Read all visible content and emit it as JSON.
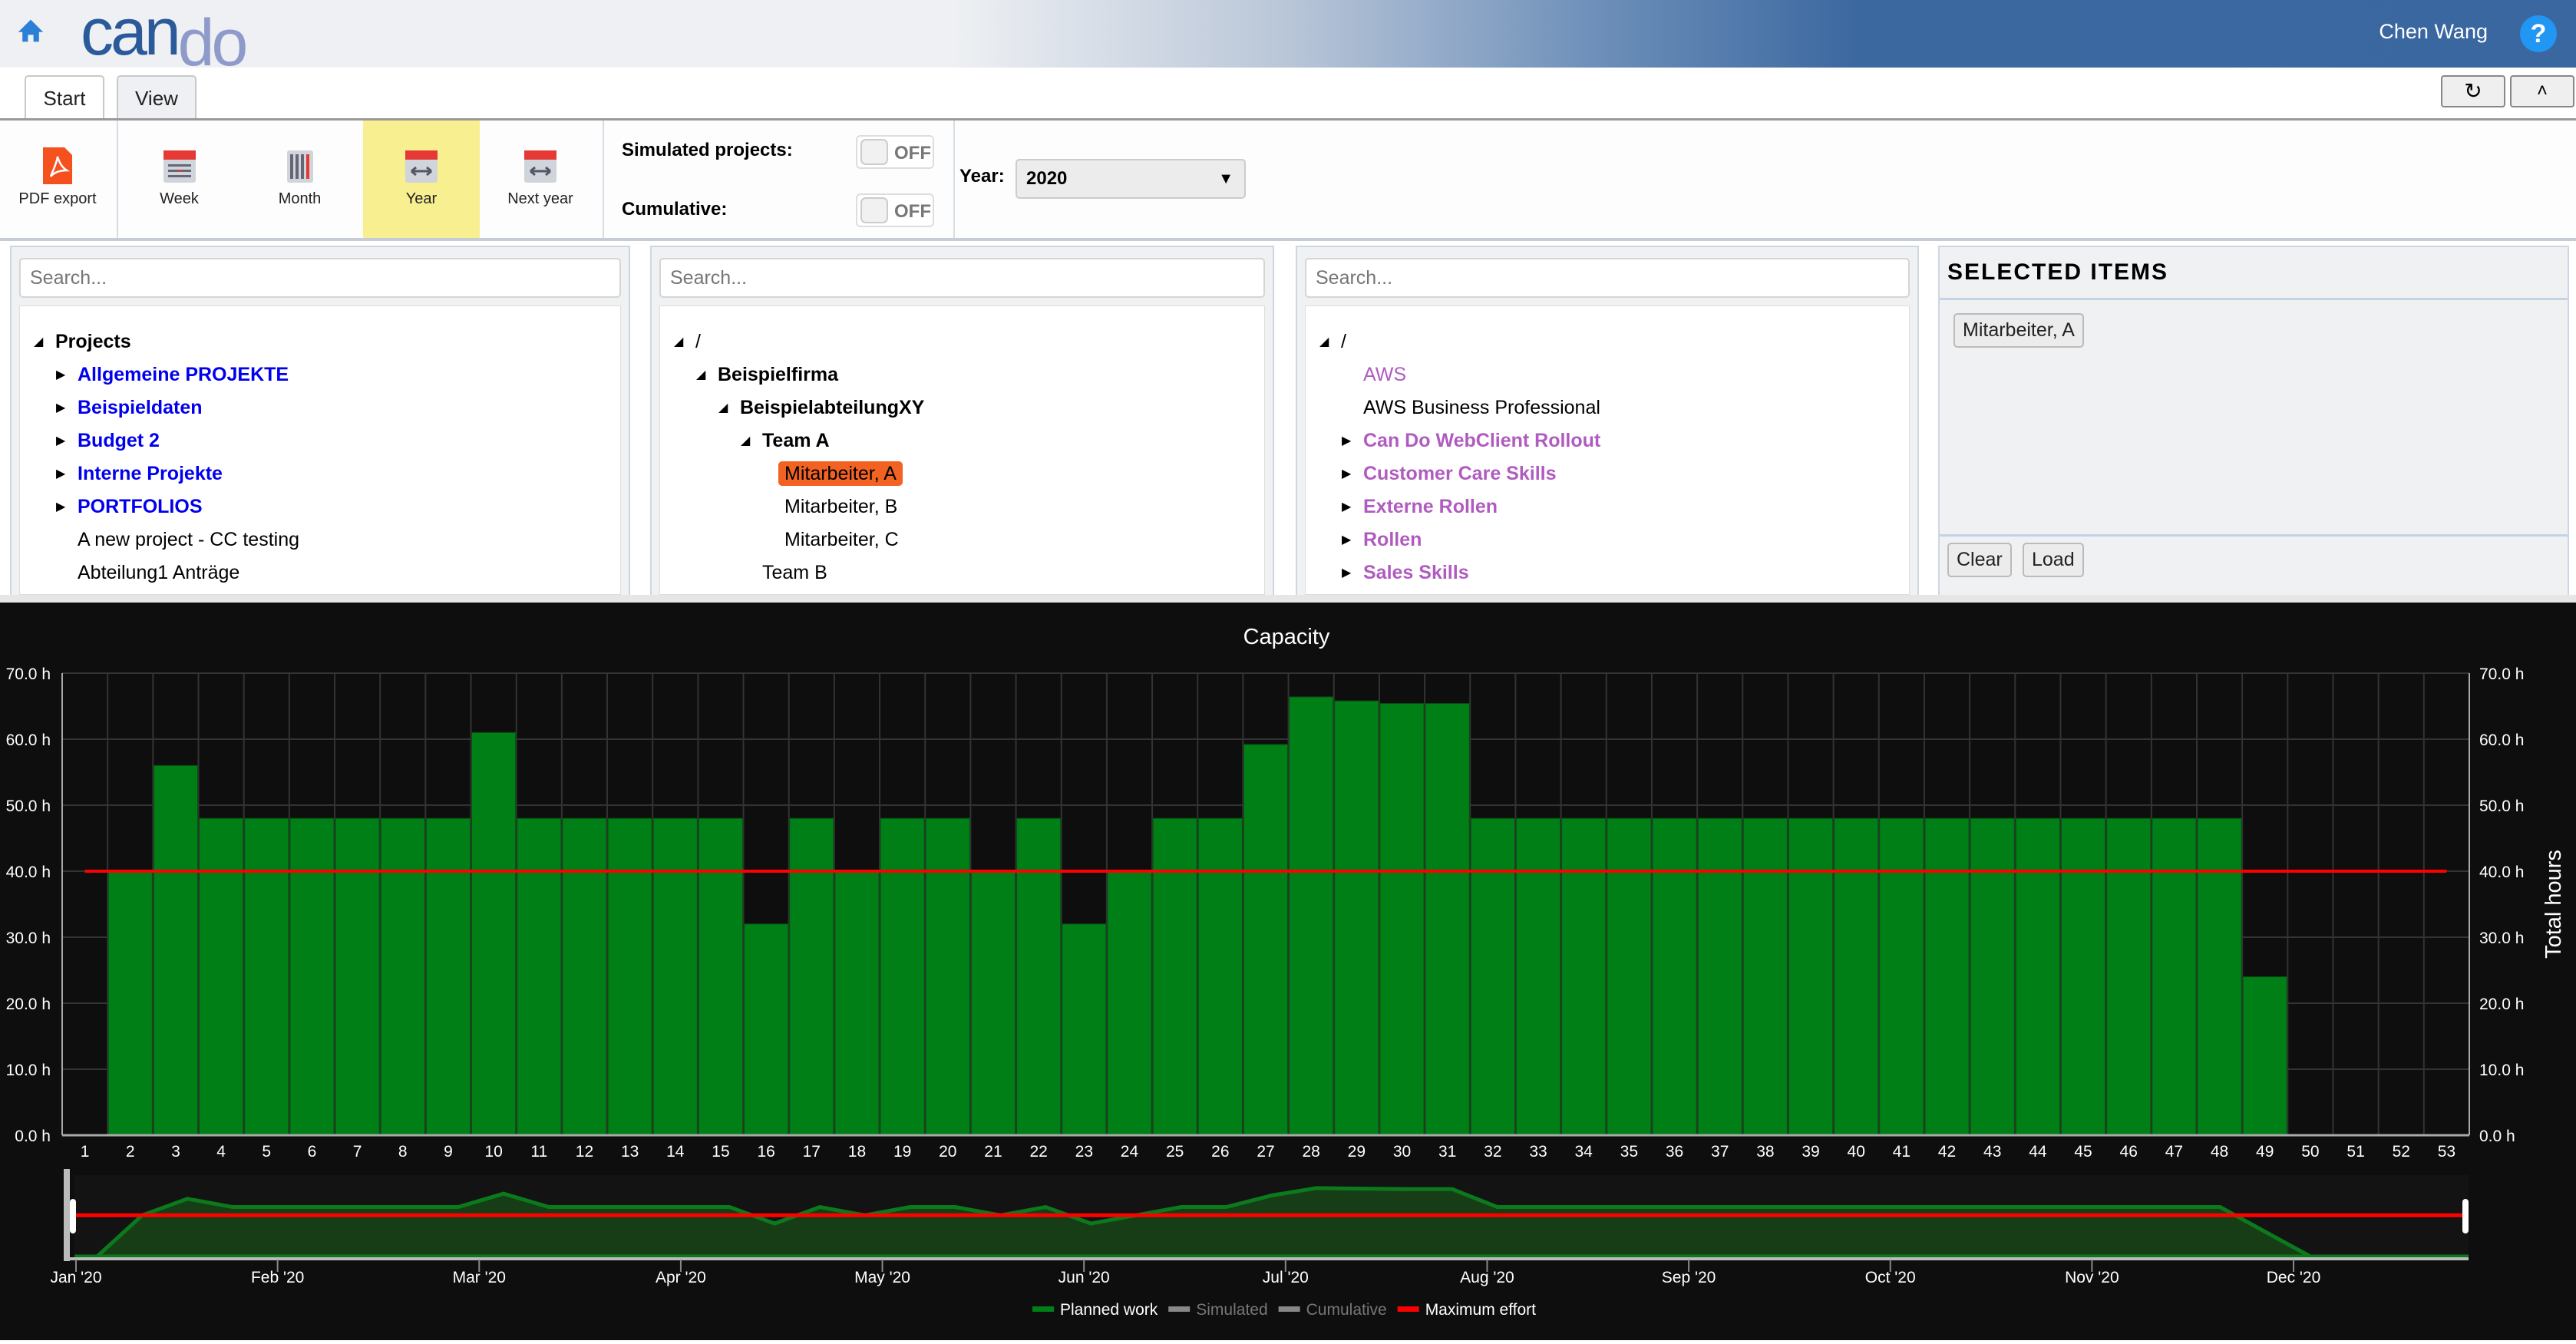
{
  "header": {
    "logo": "cando",
    "user": "Chen Wang",
    "help": "?"
  },
  "tabs": [
    {
      "label": "Start"
    },
    {
      "label": "View"
    }
  ],
  "toolbar": {
    "buttons": [
      {
        "label": "PDF export",
        "icon": "pdf-icon"
      },
      {
        "label": "Week",
        "icon": "calendar-week-icon"
      },
      {
        "label": "Month",
        "icon": "calendar-month-icon"
      },
      {
        "label": "Year",
        "icon": "calendar-year-icon",
        "active": true
      },
      {
        "label": "Next year",
        "icon": "calendar-next-year-icon"
      }
    ],
    "simulated_label": "Simulated projects:",
    "simulated_value": "OFF",
    "cumulative_label": "Cumulative:",
    "cumulative_value": "OFF",
    "year_label": "Year:",
    "year_value": "2020",
    "active_color": "#f8ef91"
  },
  "panels": {
    "search_placeholder": "Search...",
    "projects": [
      {
        "label": "Projects",
        "lvl": 0,
        "tri": "open",
        "style": "b"
      },
      {
        "label": "Allgemeine PROJEKTE",
        "lvl": 1,
        "tri": "closed",
        "style": "blue"
      },
      {
        "label": "Beispieldaten",
        "lvl": 1,
        "tri": "closed",
        "style": "blue"
      },
      {
        "label": "Budget 2",
        "lvl": 1,
        "tri": "closed",
        "style": "blue"
      },
      {
        "label": "Interne Projekte",
        "lvl": 1,
        "tri": "closed",
        "style": "blue"
      },
      {
        "label": "PORTFOLIOS",
        "lvl": 1,
        "tri": "closed",
        "style": "blue"
      },
      {
        "label": "A new project - CC testing",
        "lvl": 1,
        "tri": "",
        "style": ""
      },
      {
        "label": "Abteilung1 Anträge",
        "lvl": 1,
        "tri": "",
        "style": ""
      }
    ],
    "org": [
      {
        "label": "/",
        "lvl": 0,
        "tri": "open",
        "style": ""
      },
      {
        "label": "Beispielfirma",
        "lvl": 1,
        "tri": "open",
        "style": "b"
      },
      {
        "label": "BeispielabteilungXY",
        "lvl": 2,
        "tri": "open",
        "style": "b"
      },
      {
        "label": "Team A",
        "lvl": 3,
        "tri": "open",
        "style": "b"
      },
      {
        "label": "Mitarbeiter, A",
        "lvl": 4,
        "tri": "",
        "style": "sel"
      },
      {
        "label": "Mitarbeiter, B",
        "lvl": 4,
        "tri": "",
        "style": ""
      },
      {
        "label": "Mitarbeiter, C",
        "lvl": 4,
        "tri": "",
        "style": ""
      },
      {
        "label": "Team B",
        "lvl": 3,
        "tri": "",
        "style": ""
      }
    ],
    "roles": [
      {
        "label": "/",
        "lvl": 0,
        "tri": "open",
        "style": ""
      },
      {
        "label": "AWS",
        "lvl": 1,
        "tri": "",
        "style": "purple"
      },
      {
        "label": "AWS Business Professional",
        "lvl": 1,
        "tri": "",
        "style": ""
      },
      {
        "label": "Can Do WebClient Rollout",
        "lvl": 1,
        "tri": "closed",
        "style": "purpleb"
      },
      {
        "label": "Customer Care Skills",
        "lvl": 1,
        "tri": "closed",
        "style": "purpleb"
      },
      {
        "label": "Externe Rollen",
        "lvl": 1,
        "tri": "closed",
        "style": "purpleb"
      },
      {
        "label": "Rollen",
        "lvl": 1,
        "tri": "closed",
        "style": "purpleb"
      },
      {
        "label": "Sales Skills",
        "lvl": 1,
        "tri": "closed",
        "style": "purpleb"
      }
    ],
    "selected": {
      "title": "SELECTED ITEMS",
      "items": [
        "Mitarbeiter, A"
      ],
      "clear": "Clear",
      "load": "Load"
    }
  },
  "chart_data": {
    "type": "bar",
    "title": "Capacity",
    "ylabel": "Total hours",
    "ylim": [
      0,
      70
    ],
    "yticks": [
      "0.0 h",
      "10.0 h",
      "20.0 h",
      "30.0 h",
      "40.0 h",
      "50.0 h",
      "60.0 h",
      "70.0 h"
    ],
    "categories": [
      1,
      2,
      3,
      4,
      5,
      6,
      7,
      8,
      9,
      10,
      11,
      12,
      13,
      14,
      15,
      16,
      17,
      18,
      19,
      20,
      21,
      22,
      23,
      24,
      25,
      26,
      27,
      28,
      29,
      30,
      31,
      32,
      33,
      34,
      35,
      36,
      37,
      38,
      39,
      40,
      41,
      42,
      43,
      44,
      45,
      46,
      47,
      48,
      49,
      50,
      51,
      52,
      53
    ],
    "series": [
      {
        "name": "Planned work",
        "color": "#007f17",
        "values": [
          0,
          40,
          56,
          48,
          48,
          48,
          48,
          48,
          48,
          61,
          48,
          48,
          48,
          48,
          48,
          32,
          48,
          40,
          48,
          48,
          40,
          48,
          32,
          40,
          48,
          48,
          59.2,
          66.4,
          65.8,
          65.4,
          65.4,
          48,
          48,
          48,
          48,
          48,
          48,
          48,
          48,
          48,
          48,
          48,
          48,
          48,
          48,
          48,
          48,
          48,
          24,
          0,
          0,
          0,
          0
        ]
      },
      {
        "name": "Simulated",
        "color": "#888888",
        "values": []
      },
      {
        "name": "Cumulative",
        "color": "#888888",
        "values": []
      },
      {
        "name": "Maximum effort",
        "color": "#ff0000",
        "values": [
          40
        ]
      }
    ],
    "navigator_labels": [
      "Jan '20",
      "Feb '20",
      "Mar '20",
      "Apr '20",
      "May '20",
      "Jun '20",
      "Jul '20",
      "Aug '20",
      "Sep '20",
      "Oct '20",
      "Nov '20",
      "Dec '20"
    ],
    "legend": "bottom",
    "grid": true
  }
}
